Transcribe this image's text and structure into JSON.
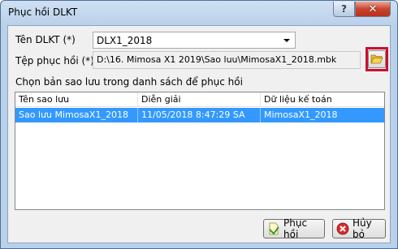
{
  "window": {
    "title": "Phục hồi DLKT"
  },
  "titlebar_buttons": {
    "help": "?",
    "close": "✕"
  },
  "form": {
    "dlkt_label": "Tên DLKT (*)",
    "dlkt_value": "DLX1_2018",
    "file_label": "Tệp phục hồi (*)",
    "file_value": "D:\\16. Mimosa X1 2019\\Sao luu\\MimosaX1_2018.mbk",
    "instruction": "Chọn bản sao lưu trong danh sách để phục hồi"
  },
  "table": {
    "columns": [
      "Tên sao lưu",
      "Diễn giải",
      "Dữ liệu kế toán"
    ],
    "rows": [
      [
        "Sao lưu MimosaX1_2018",
        "11/05/2018 8:47:29 SA",
        "MimosaX1_2018"
      ]
    ]
  },
  "buttons": {
    "restore": "Phục hồi",
    "cancel": "Hủy bỏ"
  },
  "colors": {
    "selection": "#3399ff",
    "highlight_outline": "#c8102e"
  },
  "icons": {
    "browse": "folder-open-icon",
    "restore": "restore-icon",
    "cancel": "cancel-icon"
  }
}
